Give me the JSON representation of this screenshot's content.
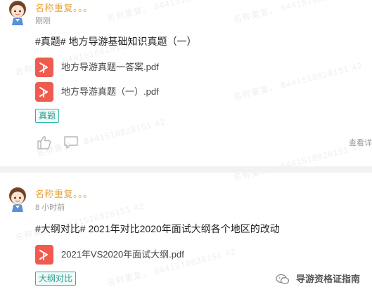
{
  "watermark_text": "名称重复。 8441518828151 42",
  "posts": [
    {
      "username": "名称重复。。。",
      "time": "刚刚",
      "text": "#真题# 地方导游基础知识真题（一）",
      "files": [
        {
          "name": "地方导游真题一答案.pdf"
        },
        {
          "name": "地方导游真题（一）.pdf"
        }
      ],
      "tag": "真题",
      "view_detail": "查看详"
    },
    {
      "username": "名称重复。。。",
      "time": "8 小时前",
      "text": "#大纲对比# 2021年对比2020年面试大纲各个地区的改动",
      "files": [
        {
          "name": "2021年VS2020年面试大纲.pdf"
        }
      ],
      "tag": "大纲对比"
    }
  ],
  "footer": {
    "wechat_account": "导游资格证指南"
  },
  "colors": {
    "username": "#e8a33d",
    "tag_border": "#2db5a8",
    "pdf_red": "#f05a4f",
    "divider": "#f2f2f2"
  }
}
